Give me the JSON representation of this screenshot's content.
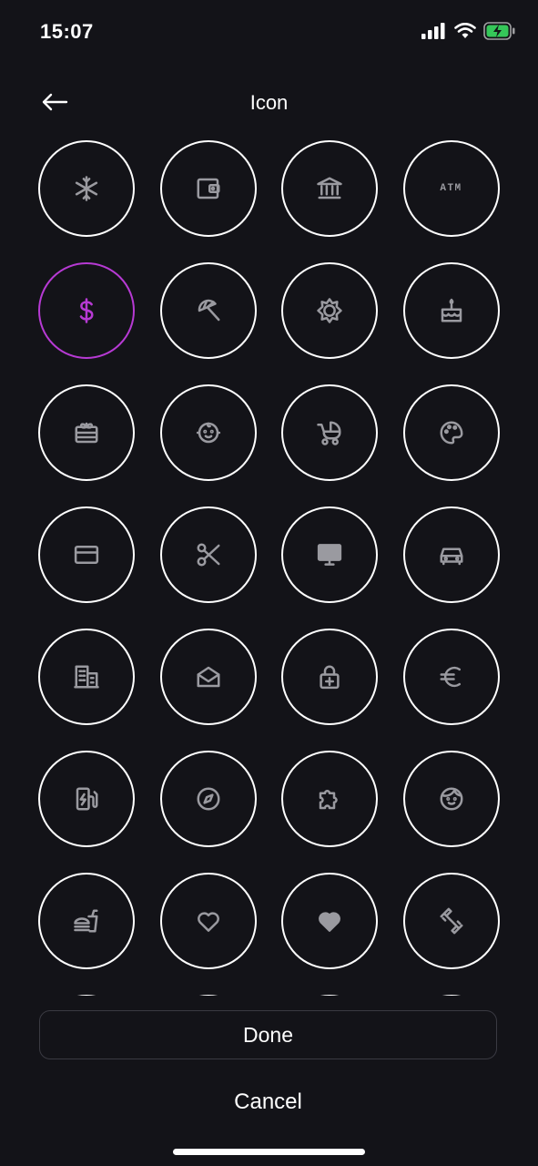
{
  "status_bar": {
    "time": "15:07",
    "icons": [
      "signal-icon",
      "wifi-icon",
      "battery-charging-icon"
    ]
  },
  "header": {
    "title": "Icon",
    "back_icon": "arrow-left-icon"
  },
  "colors": {
    "background": "#131318",
    "accent": "#b73ad4",
    "icon": "#9a9aa0",
    "border": "#ffffff"
  },
  "icons": [
    {
      "name": "snowflake-icon"
    },
    {
      "name": "wallet-icon"
    },
    {
      "name": "bank-icon"
    },
    {
      "name": "atm-icon",
      "text": "ATM"
    },
    {
      "name": "dollar-icon",
      "text": "$",
      "selected": true
    },
    {
      "name": "beach-umbrella-icon"
    },
    {
      "name": "sun-icon"
    },
    {
      "name": "birthday-cake-icon"
    },
    {
      "name": "gift-card-icon"
    },
    {
      "name": "baby-face-icon"
    },
    {
      "name": "stroller-icon"
    },
    {
      "name": "palette-icon"
    },
    {
      "name": "credit-card-icon"
    },
    {
      "name": "scissors-icon"
    },
    {
      "name": "monitor-icon"
    },
    {
      "name": "car-icon"
    },
    {
      "name": "office-building-icon"
    },
    {
      "name": "open-envelope-icon"
    },
    {
      "name": "medical-lock-icon"
    },
    {
      "name": "euro-icon"
    },
    {
      "name": "ev-charger-icon"
    },
    {
      "name": "compass-icon"
    },
    {
      "name": "puzzle-piece-icon"
    },
    {
      "name": "face-icon"
    },
    {
      "name": "fast-food-icon"
    },
    {
      "name": "heart-outline-icon"
    },
    {
      "name": "heart-filled-icon"
    },
    {
      "name": "dumbbell-icon"
    },
    {
      "name": "partial-icon-1"
    },
    {
      "name": "partial-icon-2"
    },
    {
      "name": "partial-icon-3"
    },
    {
      "name": "partial-icon-4"
    }
  ],
  "buttons": {
    "done": "Done",
    "cancel": "Cancel"
  }
}
